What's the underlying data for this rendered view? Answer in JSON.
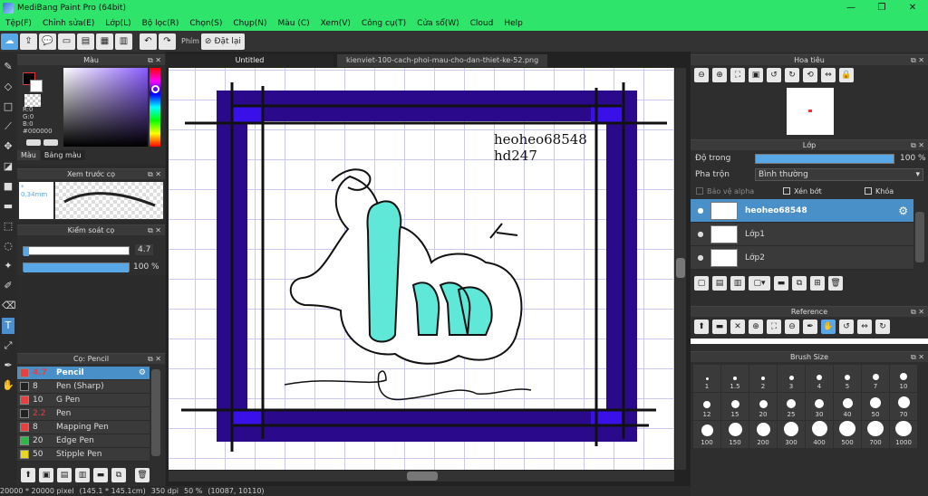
{
  "window": {
    "title": "MediBang Paint Pro (64bit)"
  },
  "menu": [
    "Tệp(F)",
    "Chỉnh sửa(E)",
    "Lớp(L)",
    "Bộ lọc(R)",
    "Chọn(S)",
    "Chụp(N)",
    "Màu (C)",
    "Xem(V)",
    "Công cụ(T)",
    "Cửa sổ(W)",
    "Cloud",
    "Help"
  ],
  "toolbar": {
    "shortcut_label": "Phím",
    "cancel_label": "Đặt lại"
  },
  "tabs": [
    "Untitled",
    "kienviet-100-cach-phoi-mau-cho-dan-thiet-ke-52.png"
  ],
  "color_panel": {
    "title": "Màu",
    "r": "R:0",
    "g": "G:0",
    "b": "B:0",
    "hex": "#000000",
    "tab_color": "Màu",
    "tab_palette": "Bảng màu"
  },
  "brush_preview": {
    "title": "Xem trước cọ",
    "size": "* 0.34mm"
  },
  "brush_control": {
    "title": "Kiểm soát cọ",
    "size": "4.7",
    "opacity": "100 %",
    "size_fraction": 0.05,
    "opacity_fraction": 1.0
  },
  "brush_list": {
    "title": "Cọ: Pencil",
    "items": [
      {
        "size": "4.7",
        "name": "Pencil",
        "color": "#e84040",
        "size_color": "#e84040",
        "active": true
      },
      {
        "size": "8",
        "name": "Pen (Sharp)",
        "color": "#222222",
        "size_color": "#dddddd",
        "active": false
      },
      {
        "size": "10",
        "name": "G Pen",
        "color": "#e84040",
        "size_color": "#dddddd",
        "active": false
      },
      {
        "size": "2.2",
        "name": "Pen",
        "color": "#222222",
        "size_color": "#e84040",
        "active": false
      },
      {
        "size": "8",
        "name": "Mapping Pen",
        "color": "#e84040",
        "size_color": "#dddddd",
        "active": false
      },
      {
        "size": "20",
        "name": "Edge Pen",
        "color": "#2fb84a",
        "size_color": "#dddddd",
        "active": false
      },
      {
        "size": "50",
        "name": "Stipple Pen",
        "color": "#e8d820",
        "size_color": "#dddddd",
        "active": false
      }
    ]
  },
  "navigator": {
    "title": "Hoa tiêu"
  },
  "layer_panel": {
    "title": "Lớp",
    "opacity_label": "Độ trong",
    "opacity_value": "100 %",
    "opacity_fraction": 1.0,
    "blend_label": "Pha trộn",
    "blend_value": "Bình thường",
    "protect_alpha": "Bảo vệ alpha",
    "clipping": "Xén bớt",
    "lock": "Khóa",
    "layers": [
      {
        "name": "heoheo68548",
        "active": true
      },
      {
        "name": "Lớp1",
        "active": false
      },
      {
        "name": "Lớp2",
        "active": false
      }
    ]
  },
  "reference": {
    "title": "Reference"
  },
  "brush_size": {
    "title": "Brush Size",
    "sizes": [
      "1",
      "1.5",
      "2",
      "3",
      "4",
      "5",
      "7",
      "10",
      "12",
      "15",
      "20",
      "25",
      "30",
      "40",
      "50",
      "70",
      "100",
      "150",
      "200",
      "300",
      "400",
      "500",
      "700",
      "1000"
    ]
  },
  "canvas": {
    "text_line1": "heoheo68548",
    "text_line2": "hd247"
  },
  "status": {
    "dims": "20000 * 20000 pixel",
    "mm": "(145.1 * 145.1cm)",
    "dpi": "350 dpi",
    "zoom": "50 %",
    "coords": "(10087, 10110)"
  }
}
